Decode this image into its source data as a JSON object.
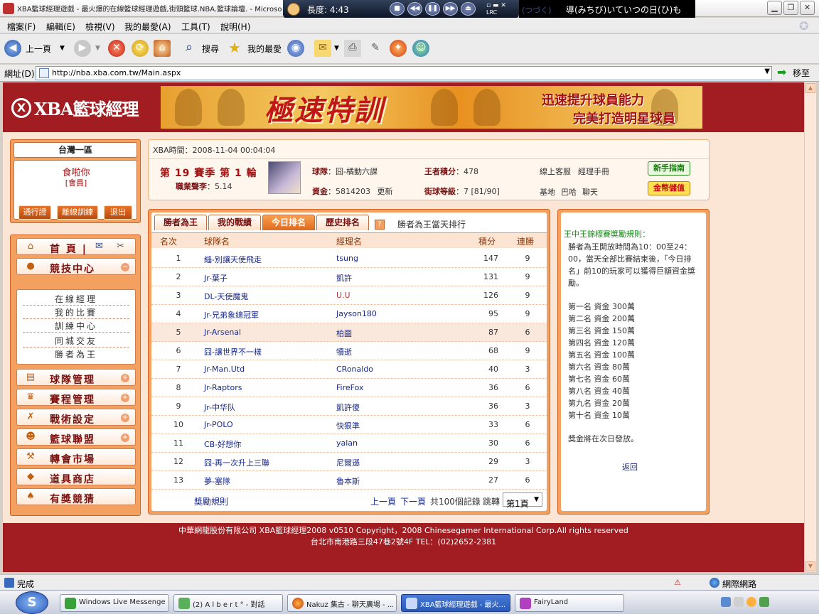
{
  "window": {
    "title": "XBA籃球經理遊戲 - 最火爆的在線籃球經理遊戲,街頭籃球.NBA.籃球論壇. - Microsoft"
  },
  "media_player": {
    "length": "長度: 4:43",
    "buttons": [
      "■",
      "◀◀",
      "❚❚",
      "▶▶",
      "⏏"
    ],
    "lrc_label": "LRC",
    "lyric_kana": "(つづく)",
    "lyric": "導(みちび)いていつの日(ひ)も"
  },
  "menu": [
    "檔案(F)",
    "編輯(E)",
    "檢視(V)",
    "我的最愛(A)",
    "工具(T)",
    "說明(H)"
  ],
  "toolbar": {
    "back": "上一頁",
    "search": "搜尋",
    "favorites": "我的最愛"
  },
  "address": {
    "label": "網址(D)",
    "url": "http://nba.xba.com.tw/Main.aspx",
    "go": "移至"
  },
  "site": {
    "logo": "XBA籃球經理",
    "banner_title": "極速特訓",
    "banner_line1": "迅速提升球員能力",
    "banner_line2": "完美打造明星球員"
  },
  "account": {
    "server": "台灣一區",
    "username": "食啦你",
    "role": "[會員]",
    "buttons": [
      "通行證",
      "離線訓練",
      "退出"
    ]
  },
  "nav": {
    "home": "首 頁 |",
    "items": [
      {
        "label": "競技中心",
        "icon": "basketball-icon",
        "expanded": true
      },
      {
        "label": "球隊管理",
        "icon": "clipboard-icon"
      },
      {
        "label": "賽程管理",
        "icon": "trophy-icon"
      },
      {
        "label": "戰術設定",
        "icon": "tactics-icon"
      },
      {
        "label": "籃球聯盟",
        "icon": "people-icon"
      },
      {
        "label": "轉會市場",
        "icon": "hammer-icon"
      },
      {
        "label": "道具商店",
        "icon": "gold-icon"
      },
      {
        "label": "有獎競猜",
        "icon": "spade-icon"
      }
    ],
    "sub_items": [
      "在線經理",
      "我的比賽",
      "訓練中心",
      "同城交友",
      "勝者為王"
    ]
  },
  "info": {
    "time": "XBA時間：2008-11-04 00:04:04",
    "season": "第 19 賽季  第 1 輪",
    "prestige_label": "職業聲李",
    "prestige_value": "：5.14",
    "team_label": "球隊",
    "team_value": "：囧-橘動六課",
    "funds_label": "資金",
    "funds_value": "：5814203",
    "update": "更新",
    "king_points_label": "王者積分",
    "king_points_value": "：478",
    "street_level_label": "街球等級",
    "street_level_value": "：7 [81/90]",
    "links_row1": [
      "線上客服",
      "經理手冊"
    ],
    "links_row2": [
      "基地",
      "巴哈",
      "聊天"
    ],
    "btn_guide": "新手指南",
    "btn_gold": "金幣儲值"
  },
  "rankings": {
    "tabs": [
      "勝者為王",
      "我的戰績",
      "今日排名",
      "歷史排名"
    ],
    "active_tab": 2,
    "help": "?",
    "subtitle": "勝者為王當天排行",
    "headers": {
      "rank": "名次",
      "team": "球隊名",
      "manager": "經理名",
      "points": "積分",
      "wins": "連勝"
    },
    "rows": [
      {
        "rank": "1",
        "team": "緇-別讓天使飛走",
        "manager": "tsung",
        "points": "147",
        "wins": "9"
      },
      {
        "rank": "2",
        "team": "Jr-葉子",
        "manager": "凱許",
        "points": "131",
        "wins": "9"
      },
      {
        "rank": "3",
        "team": "DL-天使魔鬼",
        "manager": "U.U",
        "points": "126",
        "wins": "9"
      },
      {
        "rank": "4",
        "team": "Jr-兄弟象總冠軍",
        "manager": "Jayson180",
        "points": "95",
        "wins": "9"
      },
      {
        "rank": "5",
        "team": "Jr-Arsenal",
        "manager": "柏圖",
        "points": "87",
        "wins": "6"
      },
      {
        "rank": "6",
        "team": "囧-讓世界不一樣",
        "manager": "犢逝",
        "points": "68",
        "wins": "9"
      },
      {
        "rank": "7",
        "team": "Jr-Man.Utd",
        "manager": "CRonaldo",
        "points": "40",
        "wins": "3"
      },
      {
        "rank": "8",
        "team": "Jr-Raptors",
        "manager": "FireFox",
        "points": "36",
        "wins": "6"
      },
      {
        "rank": "9",
        "team": "Jr-中华队",
        "manager": "凱許傻",
        "points": "36",
        "wins": "3"
      },
      {
        "rank": "10",
        "team": "Jr-POLO",
        "manager": "快狠準",
        "points": "33",
        "wins": "6"
      },
      {
        "rank": "11",
        "team": "CB-好想你",
        "manager": "yalan",
        "points": "30",
        "wins": "6"
      },
      {
        "rank": "12",
        "team": "囧-再一次升上三聯",
        "manager": "尼爾遜",
        "points": "29",
        "wins": "3"
      },
      {
        "rank": "13",
        "team": "夢-塞隊",
        "manager": "魯本斯",
        "points": "27",
        "wins": "6"
      }
    ],
    "footer": {
      "rules_link": "獎勵規則",
      "prev": "上一頁",
      "next": "下一頁",
      "total": "共100個記錄",
      "jump": "跳轉",
      "page": "第1頁"
    }
  },
  "rules": {
    "title": "王中王錦標賽獎勵規則：",
    "text": "勝者為王開放時間為10：00至24：00，當天全部比賽結束後，「今日排名」前10的玩家可以獲得巨額資金獎勵。",
    "prizes": [
      "第一名 資金  300萬",
      "第二名 資金   200萬",
      "第三名 資金   150萬",
      "第四名 資金   120萬",
      "第五名 資金   100萬",
      "第六名 資金    80萬",
      "第七名 資金    60萬",
      "第八名 資金    40萬",
      "第九名 資金    20萬",
      "第十名 資金    10萬"
    ],
    "note": "獎金將在次日發放。",
    "back": "返回"
  },
  "footer": {
    "line1": "中華網龍股份有限公司  XBA籃球經理2008 v0510     Copyright，2008 Chinesegamer International Corp.All rights reserved",
    "line2": "台北市南港路三段47巷2號4F TEL：(02)2652-2381"
  },
  "status": {
    "text": "完成",
    "zone": "網際網路"
  },
  "taskbar": {
    "tasks": [
      {
        "label": "Windows Live Messenger",
        "active": false
      },
      {
        "label": "(2) A l b e r t ° - 對話",
        "active": false
      },
      {
        "label": "Nakuz 集古 - 聊天廣場 - ...",
        "active": false
      },
      {
        "label": "XBA籃球經理遊戲 - 最火...",
        "active": true
      },
      {
        "label": "FairyLand",
        "active": false
      }
    ]
  }
}
